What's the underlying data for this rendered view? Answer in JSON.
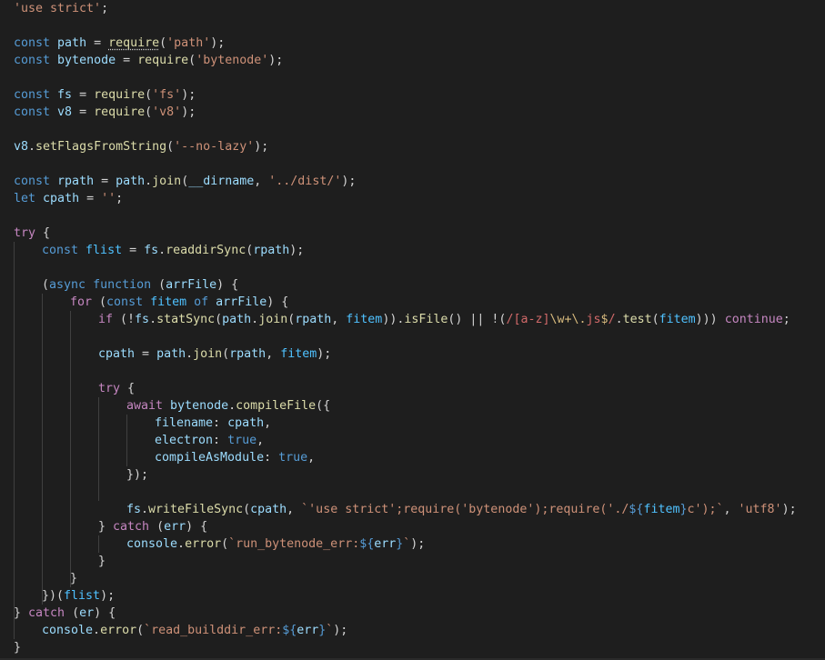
{
  "editor": {
    "language": "javascript",
    "colors": {
      "background": "#1e1e1e",
      "plain": "#d4d4d4",
      "keyword": "#569cd6",
      "control": "#c586c0",
      "string": "#ce9178",
      "function": "#dcdcaa",
      "variable": "#9cdcfe",
      "constant": "#4fc1ff",
      "regex": "#d16969",
      "regex_escape": "#d7ba7d",
      "indent_guide": "#404040"
    },
    "lines": [
      {
        "indent": 0,
        "tokens": [
          [
            "'use strict'",
            "str"
          ],
          [
            ";",
            "p"
          ]
        ]
      },
      {
        "indent": 0,
        "tokens": []
      },
      {
        "indent": 0,
        "tokens": [
          [
            "const",
            "kw"
          ],
          [
            " ",
            "p"
          ],
          [
            "path",
            "var"
          ],
          [
            " = ",
            "p"
          ],
          [
            "require",
            "fn",
            "squiggle"
          ],
          [
            "(",
            "p"
          ],
          [
            "'path'",
            "str"
          ],
          [
            ");",
            "p"
          ]
        ]
      },
      {
        "indent": 0,
        "tokens": [
          [
            "const",
            "kw"
          ],
          [
            " ",
            "p"
          ],
          [
            "bytenode",
            "var"
          ],
          [
            " = ",
            "p"
          ],
          [
            "require",
            "fn"
          ],
          [
            "(",
            "p"
          ],
          [
            "'bytenode'",
            "str"
          ],
          [
            ");",
            "p"
          ]
        ]
      },
      {
        "indent": 0,
        "tokens": []
      },
      {
        "indent": 0,
        "tokens": [
          [
            "const",
            "kw"
          ],
          [
            " ",
            "p"
          ],
          [
            "fs",
            "var"
          ],
          [
            " = ",
            "p"
          ],
          [
            "require",
            "fn"
          ],
          [
            "(",
            "p"
          ],
          [
            "'fs'",
            "str"
          ],
          [
            ");",
            "p"
          ]
        ]
      },
      {
        "indent": 0,
        "tokens": [
          [
            "const",
            "kw"
          ],
          [
            " ",
            "p"
          ],
          [
            "v8",
            "var"
          ],
          [
            " = ",
            "p"
          ],
          [
            "require",
            "fn"
          ],
          [
            "(",
            "p"
          ],
          [
            "'v8'",
            "str"
          ],
          [
            ");",
            "p"
          ]
        ]
      },
      {
        "indent": 0,
        "tokens": []
      },
      {
        "indent": 0,
        "tokens": [
          [
            "v8",
            "var"
          ],
          [
            ".",
            "p"
          ],
          [
            "setFlagsFromString",
            "fn"
          ],
          [
            "(",
            "p"
          ],
          [
            "'--no-lazy'",
            "str"
          ],
          [
            ");",
            "p"
          ]
        ]
      },
      {
        "indent": 0,
        "tokens": []
      },
      {
        "indent": 0,
        "tokens": [
          [
            "const",
            "kw"
          ],
          [
            " ",
            "p"
          ],
          [
            "rpath",
            "var"
          ],
          [
            " = ",
            "p"
          ],
          [
            "path",
            "var"
          ],
          [
            ".",
            "p"
          ],
          [
            "join",
            "fn"
          ],
          [
            "(",
            "p"
          ],
          [
            "__dirname",
            "var"
          ],
          [
            ", ",
            "p"
          ],
          [
            "'../dist/'",
            "str"
          ],
          [
            ");",
            "p"
          ]
        ]
      },
      {
        "indent": 0,
        "tokens": [
          [
            "let",
            "kw"
          ],
          [
            " ",
            "p"
          ],
          [
            "cpath",
            "var"
          ],
          [
            " = ",
            "p"
          ],
          [
            "''",
            "str"
          ],
          [
            ";",
            "p"
          ]
        ]
      },
      {
        "indent": 0,
        "tokens": []
      },
      {
        "indent": 0,
        "tokens": [
          [
            "try",
            "ctl"
          ],
          [
            " {",
            "p"
          ]
        ]
      },
      {
        "indent": 1,
        "tokens": [
          [
            "const",
            "kw"
          ],
          [
            " ",
            "p"
          ],
          [
            "flist",
            "const"
          ],
          [
            " = ",
            "p"
          ],
          [
            "fs",
            "var"
          ],
          [
            ".",
            "p"
          ],
          [
            "readdirSync",
            "fn"
          ],
          [
            "(",
            "p"
          ],
          [
            "rpath",
            "var"
          ],
          [
            ");",
            "p"
          ]
        ]
      },
      {
        "indent": 1,
        "tokens": []
      },
      {
        "indent": 1,
        "tokens": [
          [
            "(",
            "p"
          ],
          [
            "async",
            "kw"
          ],
          [
            " ",
            "p"
          ],
          [
            "function",
            "kw"
          ],
          [
            " (",
            "p"
          ],
          [
            "arrFile",
            "var"
          ],
          [
            ") {",
            "p"
          ]
        ]
      },
      {
        "indent": 2,
        "tokens": [
          [
            "for",
            "ctl"
          ],
          [
            " (",
            "p"
          ],
          [
            "const",
            "kw"
          ],
          [
            " ",
            "p"
          ],
          [
            "fitem",
            "const"
          ],
          [
            " ",
            "p"
          ],
          [
            "of",
            "kw"
          ],
          [
            " ",
            "p"
          ],
          [
            "arrFile",
            "var"
          ],
          [
            ") {",
            "p"
          ]
        ]
      },
      {
        "indent": 3,
        "tokens": [
          [
            "if",
            "ctl"
          ],
          [
            " (!",
            "p"
          ],
          [
            "fs",
            "var"
          ],
          [
            ".",
            "p"
          ],
          [
            "statSync",
            "fn"
          ],
          [
            "(",
            "p"
          ],
          [
            "path",
            "var"
          ],
          [
            ".",
            "p"
          ],
          [
            "join",
            "fn"
          ],
          [
            "(",
            "p"
          ],
          [
            "rpath",
            "var"
          ],
          [
            ", ",
            "p"
          ],
          [
            "fitem",
            "const"
          ],
          [
            ")).",
            "p"
          ],
          [
            "isFile",
            "fn"
          ],
          [
            "() || !(",
            "p"
          ],
          [
            "/",
            "rx"
          ],
          [
            "[a-z]",
            "rx"
          ],
          [
            "\\w",
            "rxe"
          ],
          [
            "+",
            "rxe"
          ],
          [
            "\\.",
            "rxe"
          ],
          [
            "js",
            "rx"
          ],
          [
            "$",
            "rxe"
          ],
          [
            "/",
            "rx"
          ],
          [
            ".",
            "p"
          ],
          [
            "test",
            "fn"
          ],
          [
            "(",
            "p"
          ],
          [
            "fitem",
            "const"
          ],
          [
            ")))",
            "p"
          ],
          [
            " ",
            "p"
          ],
          [
            "continue",
            "ctl"
          ],
          [
            ";",
            "p"
          ]
        ]
      },
      {
        "indent": 3,
        "tokens": []
      },
      {
        "indent": 3,
        "tokens": [
          [
            "cpath",
            "var"
          ],
          [
            " = ",
            "p"
          ],
          [
            "path",
            "var"
          ],
          [
            ".",
            "p"
          ],
          [
            "join",
            "fn"
          ],
          [
            "(",
            "p"
          ],
          [
            "rpath",
            "var"
          ],
          [
            ", ",
            "p"
          ],
          [
            "fitem",
            "const"
          ],
          [
            ");",
            "p"
          ]
        ]
      },
      {
        "indent": 3,
        "tokens": []
      },
      {
        "indent": 3,
        "tokens": [
          [
            "try",
            "ctl"
          ],
          [
            " {",
            "p"
          ]
        ]
      },
      {
        "indent": 4,
        "tokens": [
          [
            "await",
            "ctl"
          ],
          [
            " ",
            "p"
          ],
          [
            "bytenode",
            "var"
          ],
          [
            ".",
            "p"
          ],
          [
            "compileFile",
            "fn"
          ],
          [
            "({",
            "p"
          ]
        ]
      },
      {
        "indent": 5,
        "tokens": [
          [
            "filename",
            "var"
          ],
          [
            ": ",
            "p"
          ],
          [
            "cpath",
            "var"
          ],
          [
            ",",
            "p"
          ]
        ]
      },
      {
        "indent": 5,
        "tokens": [
          [
            "electron",
            "var"
          ],
          [
            ": ",
            "p"
          ],
          [
            "true",
            "kw"
          ],
          [
            ",",
            "p"
          ]
        ]
      },
      {
        "indent": 5,
        "tokens": [
          [
            "compileAsModule",
            "var"
          ],
          [
            ": ",
            "p"
          ],
          [
            "true",
            "kw"
          ],
          [
            ",",
            "p"
          ]
        ]
      },
      {
        "indent": 4,
        "tokens": [
          [
            "});",
            "p"
          ]
        ]
      },
      {
        "indent": 4,
        "tokens": []
      },
      {
        "indent": 4,
        "tokens": [
          [
            "fs",
            "var"
          ],
          [
            ".",
            "p"
          ],
          [
            "writeFileSync",
            "fn"
          ],
          [
            "(",
            "p"
          ],
          [
            "cpath",
            "var"
          ],
          [
            ", ",
            "p"
          ],
          [
            "`'use strict';require('bytenode');require('./",
            "str"
          ],
          [
            "${",
            "kw"
          ],
          [
            "fitem",
            "const"
          ],
          [
            "}",
            "kw"
          ],
          [
            "c');`",
            "str"
          ],
          [
            ", ",
            "p"
          ],
          [
            "'utf8'",
            "str"
          ],
          [
            ");",
            "p"
          ]
        ]
      },
      {
        "indent": 3,
        "tokens": [
          [
            "}",
            "p"
          ],
          [
            " ",
            "p"
          ],
          [
            "catch",
            "ctl"
          ],
          [
            " (",
            "p"
          ],
          [
            "err",
            "var"
          ],
          [
            ") {",
            "p"
          ]
        ]
      },
      {
        "indent": 4,
        "tokens": [
          [
            "console",
            "var"
          ],
          [
            ".",
            "p"
          ],
          [
            "error",
            "fn"
          ],
          [
            "(",
            "p"
          ],
          [
            "`run_bytenode_err:",
            "str"
          ],
          [
            "${",
            "kw"
          ],
          [
            "err",
            "var"
          ],
          [
            "}",
            "kw"
          ],
          [
            "`",
            "str"
          ],
          [
            ");",
            "p"
          ]
        ]
      },
      {
        "indent": 3,
        "tokens": [
          [
            "}",
            "p"
          ]
        ]
      },
      {
        "indent": 2,
        "tokens": [
          [
            "}",
            "p"
          ]
        ]
      },
      {
        "indent": 1,
        "tokens": [
          [
            "})(",
            "p"
          ],
          [
            "flist",
            "const"
          ],
          [
            ");",
            "p"
          ]
        ]
      },
      {
        "indent": 0,
        "tokens": [
          [
            "}",
            "p"
          ],
          [
            " ",
            "p"
          ],
          [
            "catch",
            "ctl"
          ],
          [
            " (",
            "p"
          ],
          [
            "er",
            "var"
          ],
          [
            ") {",
            "p"
          ]
        ]
      },
      {
        "indent": 1,
        "tokens": [
          [
            "console",
            "var"
          ],
          [
            ".",
            "p"
          ],
          [
            "error",
            "fn"
          ],
          [
            "(",
            "p"
          ],
          [
            "`read_builddir_err:",
            "str"
          ],
          [
            "${",
            "kw"
          ],
          [
            "err",
            "var"
          ],
          [
            "}",
            "kw"
          ],
          [
            "`",
            "str"
          ],
          [
            ");",
            "p"
          ]
        ]
      },
      {
        "indent": 0,
        "tokens": [
          [
            "}",
            "p"
          ]
        ]
      }
    ],
    "indent_guides": [
      {
        "level": 0,
        "from": 14,
        "to": 36
      },
      {
        "level": 1,
        "from": 17,
        "to": 34
      },
      {
        "level": 2,
        "from": 18,
        "to": 33
      },
      {
        "level": 3,
        "from": 23,
        "to": 28
      },
      {
        "level": 3,
        "from": 31,
        "to": 31
      },
      {
        "level": 4,
        "from": 24,
        "to": 26
      },
      {
        "level": 0,
        "from": 36,
        "to": 36
      }
    ]
  }
}
